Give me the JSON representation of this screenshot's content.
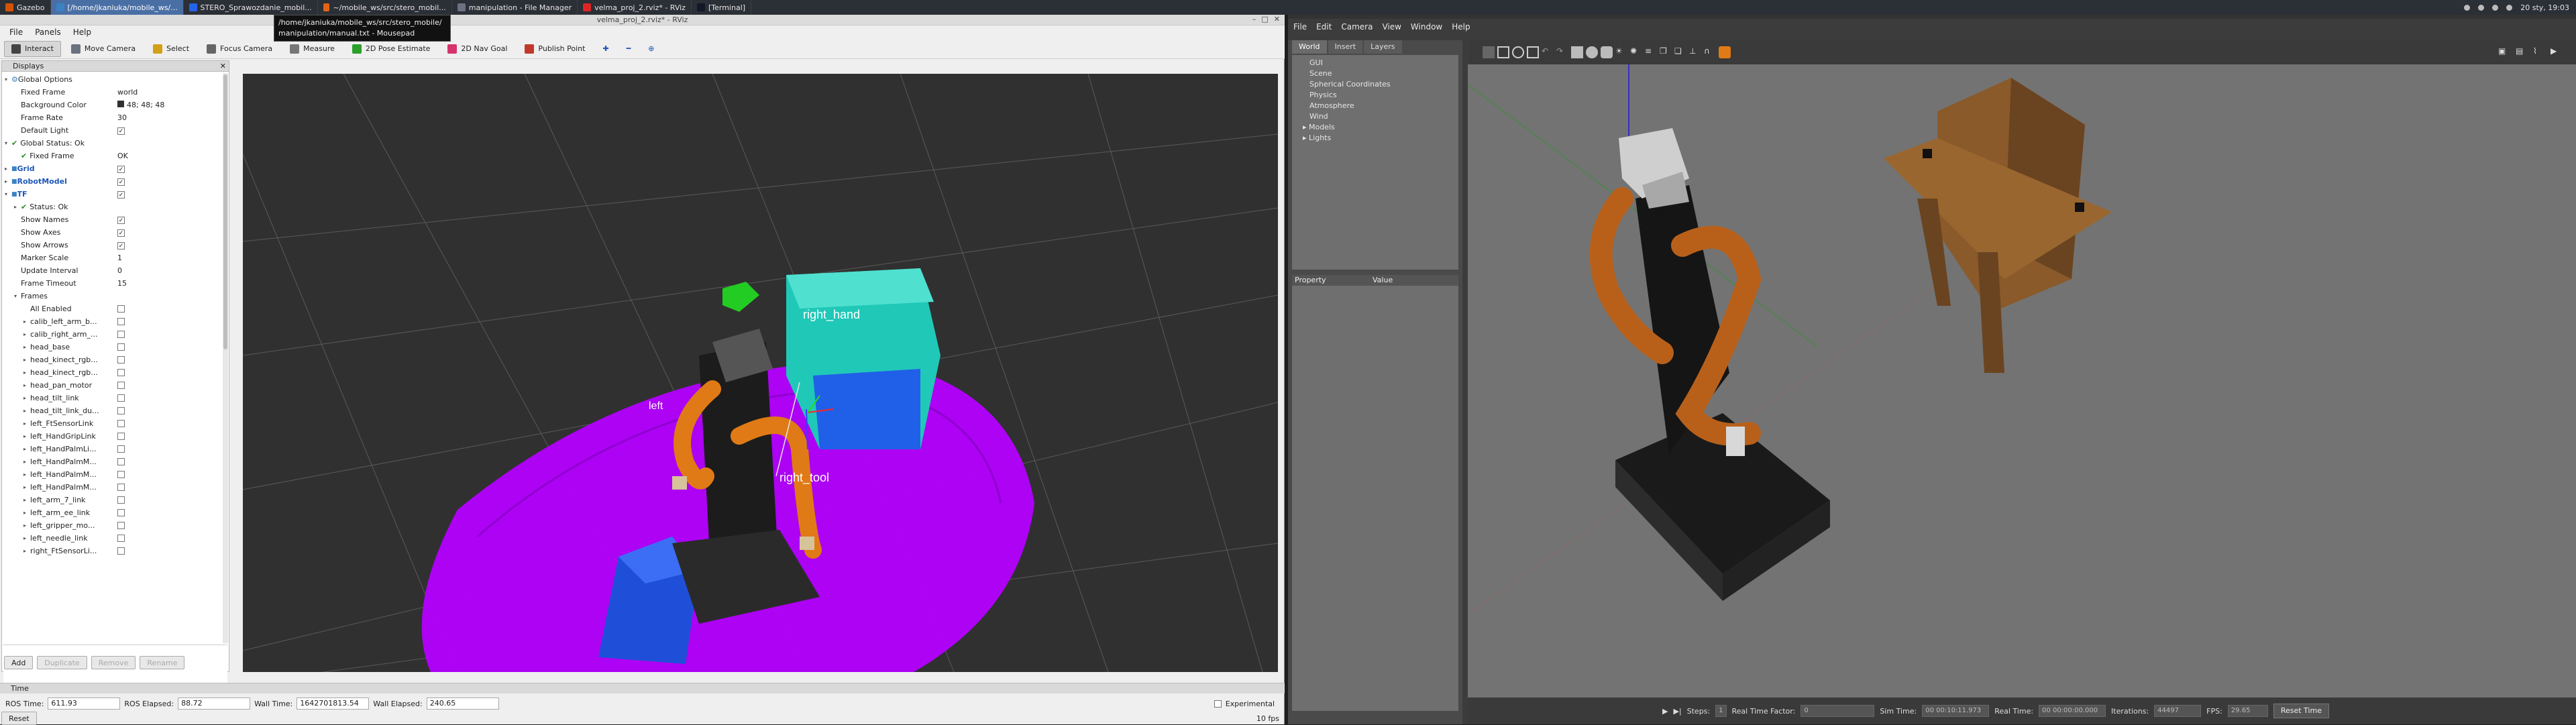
{
  "taskbar": {
    "tasks": [
      {
        "label": "Gazebo",
        "color": "#d35400"
      },
      {
        "label": "[/home/jkaniuka/mobile_ws/...",
        "color": "#3b82c4",
        "active": true
      },
      {
        "label": "STERO_Sprawozdanie_mobil...",
        "color": "#2563eb"
      },
      {
        "label": "~/mobile_ws/src/stero_mobil...",
        "color": "#e36414"
      },
      {
        "label": "manipulation - File Manager",
        "color": "#6b7280"
      },
      {
        "label": "velma_proj_2.rviz* - RViz",
        "color": "#dc2626"
      },
      {
        "label": "[Terminal]",
        "color": "#111827"
      }
    ],
    "clock": "20 sty, 19:03"
  },
  "tooltip": {
    "line1": "/home/jkaniuka/mobile_ws/src/stero_mobile/",
    "line2": "manipulation/manual.txt - Mousepad"
  },
  "rviz": {
    "title": "velma_proj_2.rviz* - RViz",
    "menu": [
      "File",
      "Panels",
      "Help"
    ],
    "toolbar": [
      {
        "label": "Interact",
        "icon": "cursor-icon",
        "selected": true
      },
      {
        "label": "Move Camera",
        "icon": "camera-move-icon"
      },
      {
        "label": "Select",
        "icon": "select-box-icon"
      },
      {
        "label": "Focus Camera",
        "icon": "focus-icon"
      },
      {
        "label": "Measure",
        "icon": "ruler-icon"
      },
      {
        "label": "2D Pose Estimate",
        "icon": "green-arrow-icon"
      },
      {
        "label": "2D Nav Goal",
        "icon": "pink-arrow-icon"
      },
      {
        "label": "Publish Point",
        "icon": "pin-icon"
      }
    ],
    "displays_title": "Displays",
    "tree": [
      {
        "level": 0,
        "arrow": "▾",
        "icon": "gear",
        "name": "Global Options",
        "value": ""
      },
      {
        "level": 1,
        "name": "Fixed Frame",
        "value": "world"
      },
      {
        "level": 1,
        "name": "Background Color",
        "value": "48; 48; 48",
        "swatch": "#303030"
      },
      {
        "level": 1,
        "name": "Frame Rate",
        "value": "30"
      },
      {
        "level": 1,
        "name": "Default Light",
        "check": true
      },
      {
        "level": 0,
        "arrow": "▾",
        "ok": true,
        "name": "Global Status: Ok",
        "value": ""
      },
      {
        "level": 1,
        "ok": true,
        "name": "Fixed Frame",
        "value": "OK"
      },
      {
        "level": 0,
        "arrow": "▸",
        "name": "Grid",
        "blue": true,
        "check": true
      },
      {
        "level": 0,
        "arrow": "▸",
        "name": "RobotModel",
        "blue": true,
        "check": true
      },
      {
        "level": 0,
        "arrow": "▾",
        "name": "TF",
        "blue": true,
        "check": true
      },
      {
        "level": 1,
        "arrow": "▸",
        "ok": true,
        "name": "Status: Ok",
        "value": ""
      },
      {
        "level": 1,
        "name": "Show Names",
        "check": true
      },
      {
        "level": 1,
        "name": "Show Axes",
        "check": true
      },
      {
        "level": 1,
        "name": "Show Arrows",
        "check": true
      },
      {
        "level": 1,
        "name": "Marker Scale",
        "value": "1"
      },
      {
        "level": 1,
        "name": "Update Interval",
        "value": "0"
      },
      {
        "level": 1,
        "name": "Frame Timeout",
        "value": "15"
      },
      {
        "level": 1,
        "arrow": "▾",
        "name": "Frames",
        "value": ""
      },
      {
        "level": 2,
        "name": "All Enabled",
        "check": false
      },
      {
        "level": 2,
        "arrow": "▸",
        "name": "calib_left_arm_b...",
        "check": false
      },
      {
        "level": 2,
        "arrow": "▸",
        "name": "calib_right_arm_...",
        "check": false
      },
      {
        "level": 2,
        "arrow": "▸",
        "name": "head_base",
        "check": false
      },
      {
        "level": 2,
        "arrow": "▸",
        "name": "head_kinect_rgb...",
        "check": false
      },
      {
        "level": 2,
        "arrow": "▸",
        "name": "head_kinect_rgb...",
        "check": false
      },
      {
        "level": 2,
        "arrow": "▸",
        "name": "head_pan_motor",
        "check": false
      },
      {
        "level": 2,
        "arrow": "▸",
        "name": "head_tilt_link",
        "check": false
      },
      {
        "level": 2,
        "arrow": "▸",
        "name": "head_tilt_link_du...",
        "check": false
      },
      {
        "level": 2,
        "arrow": "▸",
        "name": "left_FtSensorLink",
        "check": false
      },
      {
        "level": 2,
        "arrow": "▸",
        "name": "left_HandGripLink",
        "check": false
      },
      {
        "level": 2,
        "arrow": "▸",
        "name": "left_HandPalmLi...",
        "check": false
      },
      {
        "level": 2,
        "arrow": "▸",
        "name": "left_HandPalmM...",
        "check": false
      },
      {
        "level": 2,
        "arrow": "▸",
        "name": "left_HandPalmM...",
        "check": false
      },
      {
        "level": 2,
        "arrow": "▸",
        "name": "left_HandPalmM...",
        "check": false
      },
      {
        "level": 2,
        "arrow": "▸",
        "name": "left_arm_7_link",
        "check": false
      },
      {
        "level": 2,
        "arrow": "▸",
        "name": "left_arm_ee_link",
        "check": false
      },
      {
        "level": 2,
        "arrow": "▸",
        "name": "left_gripper_mo...",
        "check": false
      },
      {
        "level": 2,
        "arrow": "▸",
        "name": "left_needle_link",
        "check": false
      },
      {
        "level": 2,
        "arrow": "▸",
        "name": "right_FtSensorLi...",
        "check": false
      }
    ],
    "buttons": {
      "add": "Add",
      "duplicate": "Duplicate",
      "remove": "Remove",
      "rename": "Rename"
    },
    "view_labels": {
      "right_hand": "right_hand",
      "left": "left",
      "right_tool": "right_tool"
    },
    "time": {
      "title": "Time",
      "ros_time_label": "ROS Time:",
      "ros_time": "611.93",
      "ros_elapsed_label": "ROS Elapsed:",
      "ros_elapsed": "88.72",
      "wall_time_label": "Wall Time:",
      "wall_time": "1642701813.54",
      "wall_elapsed_label": "Wall Elapsed:",
      "wall_elapsed": "240.65",
      "experimental": "Experimental"
    },
    "reset": "Reset",
    "fps": "10 fps"
  },
  "gazebo": {
    "title": "Gazebo",
    "menu": [
      "File",
      "Edit",
      "Camera",
      "View",
      "Window",
      "Help"
    ],
    "tabs": [
      "World",
      "Insert",
      "Layers"
    ],
    "world_items": [
      "GUI",
      "Scene",
      "Spherical Coordinates",
      "Physics",
      "Atmosphere",
      "Wind",
      "Models",
      "Lights"
    ],
    "props_header": {
      "property": "Property",
      "value": "Value"
    },
    "bottom": {
      "steps_label": "Steps:",
      "steps": "1",
      "rtf_label": "Real Time Factor:",
      "rtf": "0",
      "sim_label": "Sim Time:",
      "sim": "00 00:10:11.973",
      "real_label": "Real Time:",
      "real": "00 00:00:00.000",
      "iter_label": "Iterations:",
      "iter": "44497",
      "fps_label": "FPS:",
      "fps": "29.65",
      "reset": "Reset Time"
    }
  }
}
